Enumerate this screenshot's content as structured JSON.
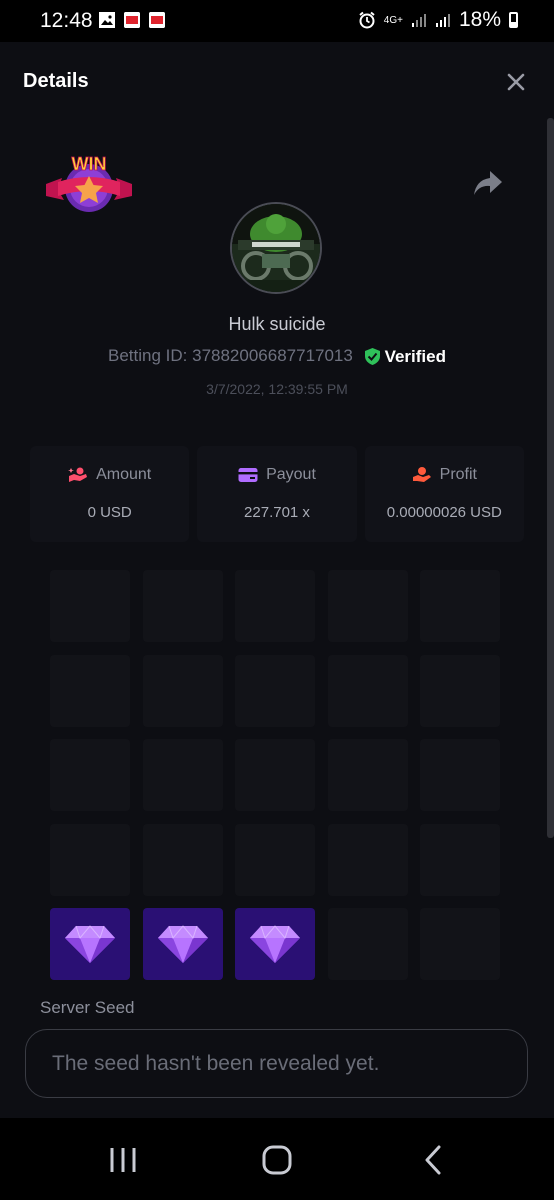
{
  "status_bar": {
    "time": "12:48",
    "network": "4G+",
    "battery": "18%"
  },
  "header": {
    "title": "Details"
  },
  "bet": {
    "badge": "WIN",
    "username": "Hulk suicide",
    "betting_id_label": "Betting ID:",
    "betting_id": "37882006687717013",
    "verified": "Verified",
    "date": "3/7/2022, 12:39:55 PM"
  },
  "stats": [
    {
      "label": "Amount",
      "value": "0 USD",
      "icon": "amount-icon",
      "color": "#ff4f6d"
    },
    {
      "label": "Payout",
      "value": "227.701 x",
      "icon": "wallet-icon",
      "color": "#b06cff"
    },
    {
      "label": "Profit",
      "value": "0.00000026 USD",
      "icon": "profit-hand-icon",
      "color": "#ff5a3c"
    }
  ],
  "grid": {
    "rows": 5,
    "cols": 5,
    "revealed_gems": 3
  },
  "seed": {
    "label": "Server Seed",
    "placeholder": "The seed hasn't been revealed yet."
  },
  "colors": {
    "background": "#0d0e13",
    "gem_tile": "#2a1074",
    "verified_green": "#2fc15a"
  }
}
